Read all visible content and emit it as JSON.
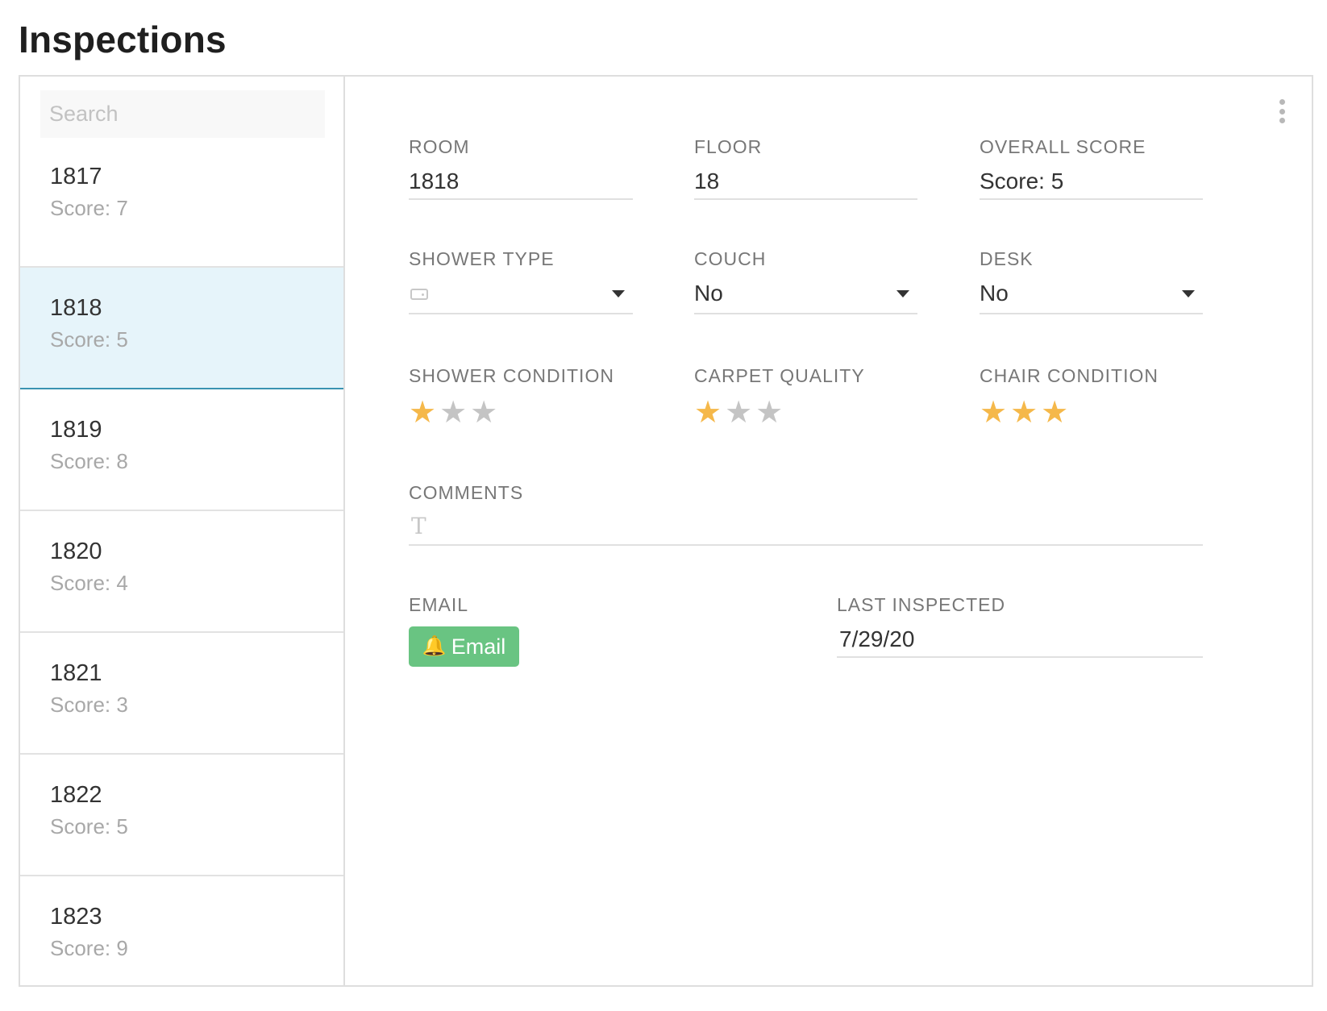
{
  "page": {
    "title": "Inspections"
  },
  "sidebar": {
    "search_placeholder": "Search",
    "items": [
      {
        "room": "1817",
        "score": "Score: 7",
        "selected": false
      },
      {
        "room": "1818",
        "score": "Score: 5",
        "selected": true
      },
      {
        "room": "1819",
        "score": "Score: 8",
        "selected": false
      },
      {
        "room": "1820",
        "score": "Score: 4",
        "selected": false
      },
      {
        "room": "1821",
        "score": "Score: 3",
        "selected": false
      },
      {
        "room": "1822",
        "score": "Score: 5",
        "selected": false
      },
      {
        "room": "1823",
        "score": "Score: 9",
        "selected": false
      }
    ]
  },
  "detail": {
    "room": {
      "label": "ROOM",
      "value": "1818"
    },
    "floor": {
      "label": "FLOOR",
      "value": "18"
    },
    "overall_score": {
      "label": "OVERALL SCORE",
      "value": "Score: 5"
    },
    "shower_type": {
      "label": "SHOWER TYPE",
      "value": "",
      "icon": "shower-icon"
    },
    "couch": {
      "label": "COUCH",
      "value": "No"
    },
    "desk": {
      "label": "DESK",
      "value": "No"
    },
    "shower_condition": {
      "label": "SHOWER CONDITION",
      "rating": 1,
      "max": 3
    },
    "carpet_quality": {
      "label": "CARPET QUALITY",
      "rating": 1,
      "max": 3
    },
    "chair_condition": {
      "label": "CHAIR CONDITION",
      "rating": 3,
      "max": 3
    },
    "comments": {
      "label": "COMMENTS",
      "value": "",
      "icon": "text-icon"
    },
    "email": {
      "label": "EMAIL",
      "button_label": "Email",
      "icon": "bell-icon",
      "color": "#69c482"
    },
    "last_inspected": {
      "label": "LAST INSPECTED",
      "value": "7/29/20"
    }
  },
  "colors": {
    "star_on": "#f5b84a",
    "star_off": "#c4c4c4",
    "selected_bg": "#e6f4fa",
    "selected_border": "#3a93b1"
  }
}
